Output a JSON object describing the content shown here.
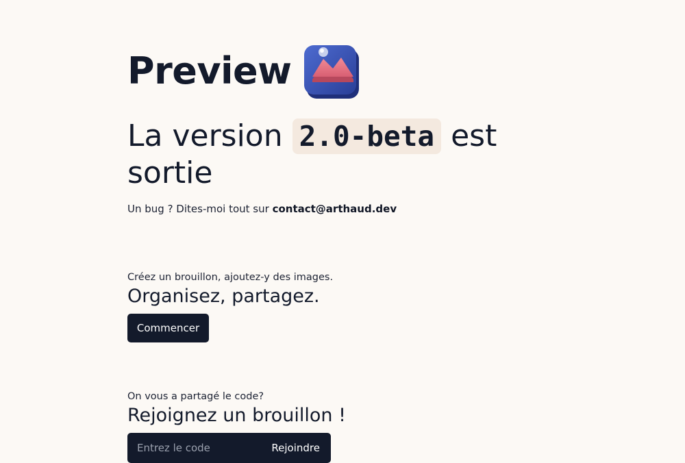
{
  "brand": {
    "title": "Preview",
    "logo_icon": "image-landscape-icon",
    "colors": {
      "tile": "#3b55b4",
      "mountain": "#ef7a86",
      "sun": "#e9ecf6"
    }
  },
  "headline": {
    "before": "La version",
    "version": "2.0-beta",
    "after": "est sortie"
  },
  "subline": {
    "text": "Un bug ? Dites-moi tout sur",
    "email": "contact@arthaud.dev"
  },
  "create_section": {
    "hint": "Créez un brouillon, ajoutez-y des images.",
    "title": "Organisez, partagez.",
    "button_label": "Commencer"
  },
  "join_section": {
    "hint": "On vous a partagé le code?",
    "title": "Rejoignez un brouillon !",
    "input_placeholder": "Entrez le code",
    "input_value": "",
    "button_label": "Rejoindre"
  },
  "colors": {
    "background": "#fcf9f5",
    "text": "#131a2b",
    "accent_dark": "#131a2b",
    "code_highlight": "#f4e9df"
  }
}
